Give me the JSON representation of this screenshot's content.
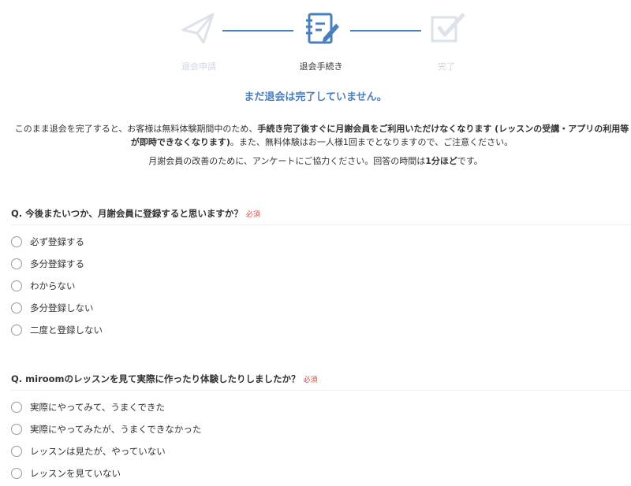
{
  "steps": [
    {
      "label": "退会申請",
      "icon": "paper-plane-icon",
      "state": "inactive"
    },
    {
      "label": "退会手続き",
      "icon": "document-pen-icon",
      "state": "active"
    },
    {
      "label": "完了",
      "icon": "checkbox-icon",
      "state": "inactive"
    }
  ],
  "colors": {
    "accent": "#4a7fbd",
    "inactive": "#dde3ea",
    "required": "#e0453a"
  },
  "headline": "まだ退会は完了していません。",
  "notice": {
    "part1": "このまま退会を完了すると、お客様は無料体験期間中のため、",
    "bold1": "手続き完了後すぐに月謝会員をご利用いただけなくなります (レッスンの受講・アプリの利用等が即時できなくなります)",
    "part2": "。また、無料体験はお一人様1回までとなりますので、ご注意ください。"
  },
  "survey_note": {
    "text": "月謝会員の改善のために、アンケートにご協力ください。回答の時間は",
    "bold": "1分ほど",
    "suffix": "です。"
  },
  "questions": [
    {
      "title": "Q. 今後またいつか、月謝会員に登録すると思いますか？",
      "required": "必須",
      "options": [
        "必ず登録する",
        "多分登録する",
        "わからない",
        "多分登録しない",
        "二度と登録しない"
      ]
    },
    {
      "title": "Q. miroomのレッスンを見て実際に作ったり体験したりしましたか？",
      "required": "必須",
      "options": [
        "実際にやってみて、うまくできた",
        "実際にやってみたが、うまくできなかった",
        "レッスンは見たが、やっていない",
        "レッスンを見ていない"
      ]
    }
  ]
}
